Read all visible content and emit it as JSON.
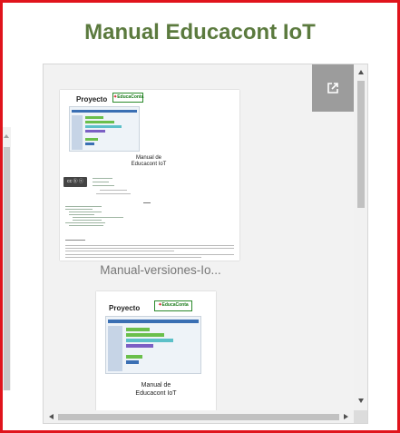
{
  "title": "Manual Educacont IoT",
  "documents": [
    {
      "page_header": "Proyecto",
      "logo_text": "EducaConta",
      "page_caption_line1": "Manual de",
      "page_caption_line2": "Educacont IoT",
      "file_name": "Manual-versiones-Io..."
    },
    {
      "page_header": "Proyecto",
      "logo_text": "EducaConta",
      "page_caption_line1": "Manual de",
      "page_caption_line2": "Educacont IoT"
    }
  ],
  "icons": {
    "popout": "open-in-new-icon"
  },
  "colors": {
    "title": "#5b7a3e",
    "highlight_border": "#e0141c",
    "popout_bg": "#9c9c9c"
  }
}
